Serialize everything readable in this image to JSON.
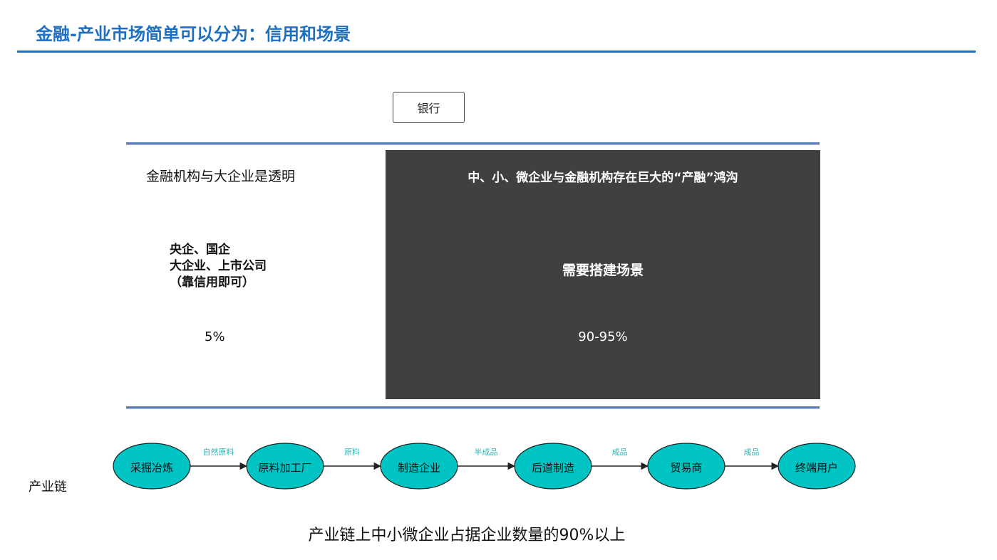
{
  "title": "金融-产业市场简单可以分为：信用和场景",
  "bank": "银行",
  "left": {
    "label": "金融机构与大企业是透明",
    "bold_lines": [
      "央企、国企",
      "大企业、上市公司",
      "（靠信用即可）"
    ],
    "percent": "5%"
  },
  "right": {
    "heading": "中、小、微企业与金融机构存在巨大的“产融”鸿沟",
    "middle": "需要搭建场景",
    "percent": "90-95%"
  },
  "chain": {
    "label": "产业链",
    "nodes": [
      "采掘冶炼",
      "原料加工厂",
      "制造企业",
      "后道制造",
      "贸易商",
      "终端用户"
    ],
    "edges": [
      "自然原料",
      "原料",
      "半成品",
      "成品",
      "成品"
    ]
  },
  "footer": "产业链上中小微企业占据企业数量的90%以上",
  "colors": {
    "title": "#1f6fc0",
    "node_fill": "#00c4c4",
    "panel": "#404040",
    "edge_label": "#2bb5b5"
  }
}
